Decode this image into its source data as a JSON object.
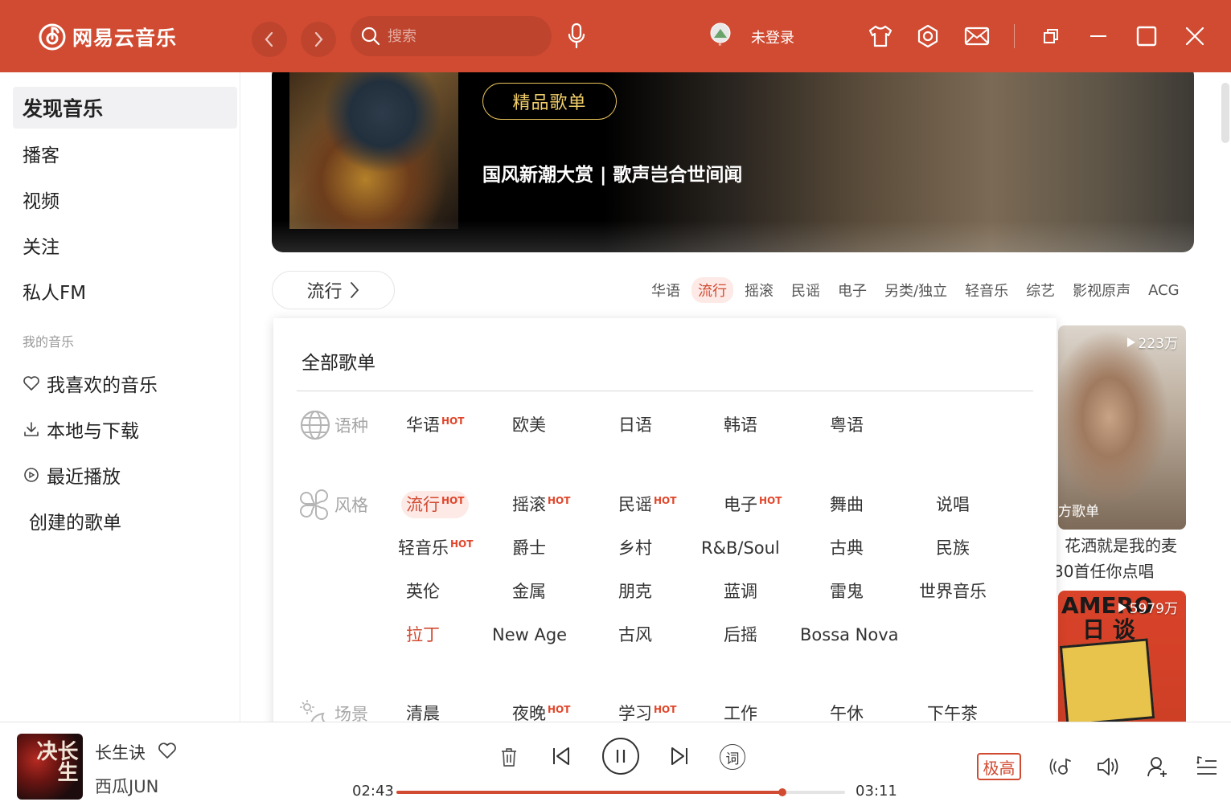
{
  "app": {
    "name": "网易云音乐"
  },
  "titlebar": {
    "search_placeholder": "搜索",
    "login_text": "未登录"
  },
  "sidebar": {
    "items": [
      {
        "label": "发现音乐"
      },
      {
        "label": "播客"
      },
      {
        "label": "视频"
      },
      {
        "label": "关注"
      },
      {
        "label": "私人FM"
      }
    ],
    "section_title": "我的音乐",
    "my_music": [
      {
        "label": "我喜欢的音乐",
        "icon": "heart-icon"
      },
      {
        "label": "本地与下载",
        "icon": "download-icon"
      },
      {
        "label": "最近播放",
        "icon": "recent-icon"
      }
    ],
    "created_playlists": "创建的歌单"
  },
  "banner": {
    "tag": "精品歌单",
    "title": "国风新潮大赏 | 歌声岂合世间闻"
  },
  "category_button": {
    "label": "流行"
  },
  "genre_tabs": [
    "华语",
    "流行",
    "摇滚",
    "民谣",
    "电子",
    "另类/独立",
    "轻音乐",
    "综艺",
    "影视原声",
    "ACG"
  ],
  "genre_tabs_active": "流行",
  "panel": {
    "title": "全部歌单",
    "hot_label": "HOT",
    "categories": [
      {
        "name": "语种",
        "icon": "globe-icon",
        "options": [
          {
            "label": "华语",
            "hot": true
          },
          {
            "label": "欧美",
            "hot": false
          },
          {
            "label": "日语",
            "hot": false
          },
          {
            "label": "韩语",
            "hot": false
          },
          {
            "label": "粤语",
            "hot": false
          }
        ]
      },
      {
        "name": "风格",
        "icon": "style-icon",
        "options": [
          {
            "label": "流行",
            "hot": true,
            "selected": true
          },
          {
            "label": "摇滚",
            "hot": true
          },
          {
            "label": "民谣",
            "hot": true
          },
          {
            "label": "电子",
            "hot": true
          },
          {
            "label": "舞曲",
            "hot": false
          },
          {
            "label": "说唱",
            "hot": false
          },
          {
            "label": "轻音乐",
            "hot": true
          },
          {
            "label": "爵士",
            "hot": false
          },
          {
            "label": "乡村",
            "hot": false
          },
          {
            "label": "R&B/Soul",
            "hot": false
          },
          {
            "label": "古典",
            "hot": false
          },
          {
            "label": "民族",
            "hot": false
          },
          {
            "label": "英伦",
            "hot": false
          },
          {
            "label": "金属",
            "hot": false
          },
          {
            "label": "朋克",
            "hot": false
          },
          {
            "label": "蓝调",
            "hot": false
          },
          {
            "label": "雷鬼",
            "hot": false
          },
          {
            "label": "世界音乐",
            "hot": false
          },
          {
            "label": "拉丁",
            "hot": false,
            "highlight": true
          },
          {
            "label": "New Age",
            "hot": false
          },
          {
            "label": "古风",
            "hot": false
          },
          {
            "label": "后摇",
            "hot": false
          },
          {
            "label": "Bossa Nova",
            "hot": false
          }
        ]
      },
      {
        "name": "场景",
        "icon": "scene-icon",
        "options": [
          {
            "label": "清晨",
            "hot": false
          },
          {
            "label": "夜晚",
            "hot": true
          },
          {
            "label": "学习",
            "hot": true
          },
          {
            "label": "工作",
            "hot": false
          },
          {
            "label": "午休",
            "hot": false
          },
          {
            "label": "下午茶",
            "hot": false
          }
        ]
      }
    ]
  },
  "cards": [
    {
      "plays": "223万",
      "badge": "方歌单",
      "desc_line1": "花洒就是我的麦",
      "desc_line2": "30首任你点唱"
    },
    {
      "plays": "5979万",
      "cover_text_line1": "AMERO",
      "cover_text_line2": "日  谈"
    }
  ],
  "player": {
    "song": "长生诀",
    "artist": "西瓜JUN",
    "album_text": "长生决",
    "current_time": "02:43",
    "total_time": "03:11",
    "progress": 0.86,
    "lyrics_icon_text": "词",
    "quality": "极高"
  },
  "colors": {
    "brand": "#d14b32",
    "hot": "#e0462b",
    "gold": "#f3cf6a"
  }
}
